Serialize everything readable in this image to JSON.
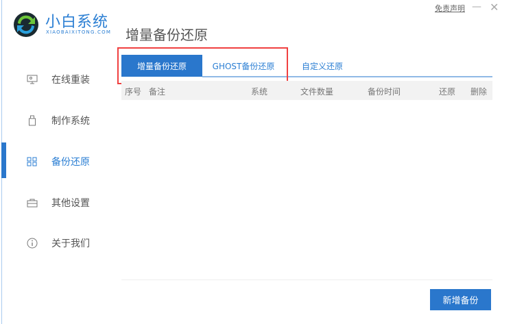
{
  "app": {
    "brand": "小白系统",
    "brand_sub": "XIAOBAIXITONG.COM",
    "disclaimer": "免责声明",
    "minimize": "—",
    "close": "✕"
  },
  "sidebar": {
    "items": [
      {
        "label": "在线重装",
        "icon": "monitor-icon"
      },
      {
        "label": "制作系统",
        "icon": "usb-icon"
      },
      {
        "label": "备份还原",
        "icon": "backup-icon",
        "active": true
      },
      {
        "label": "其他设置",
        "icon": "briefcase-icon"
      },
      {
        "label": "关于我们",
        "icon": "info-icon"
      }
    ]
  },
  "main": {
    "title": "增量备份还原",
    "tabs": [
      {
        "label": "增量备份还原",
        "active": true
      },
      {
        "label": "GHOST备份还原"
      },
      {
        "label": "自定义还原"
      }
    ],
    "columns": [
      "序号",
      "备注",
      "系统",
      "文件数量",
      "备份时间",
      "还原",
      "删除"
    ],
    "new_backup": "新增备份"
  },
  "colors": {
    "accent": "#2a77cc",
    "highlight": "#f04040"
  }
}
